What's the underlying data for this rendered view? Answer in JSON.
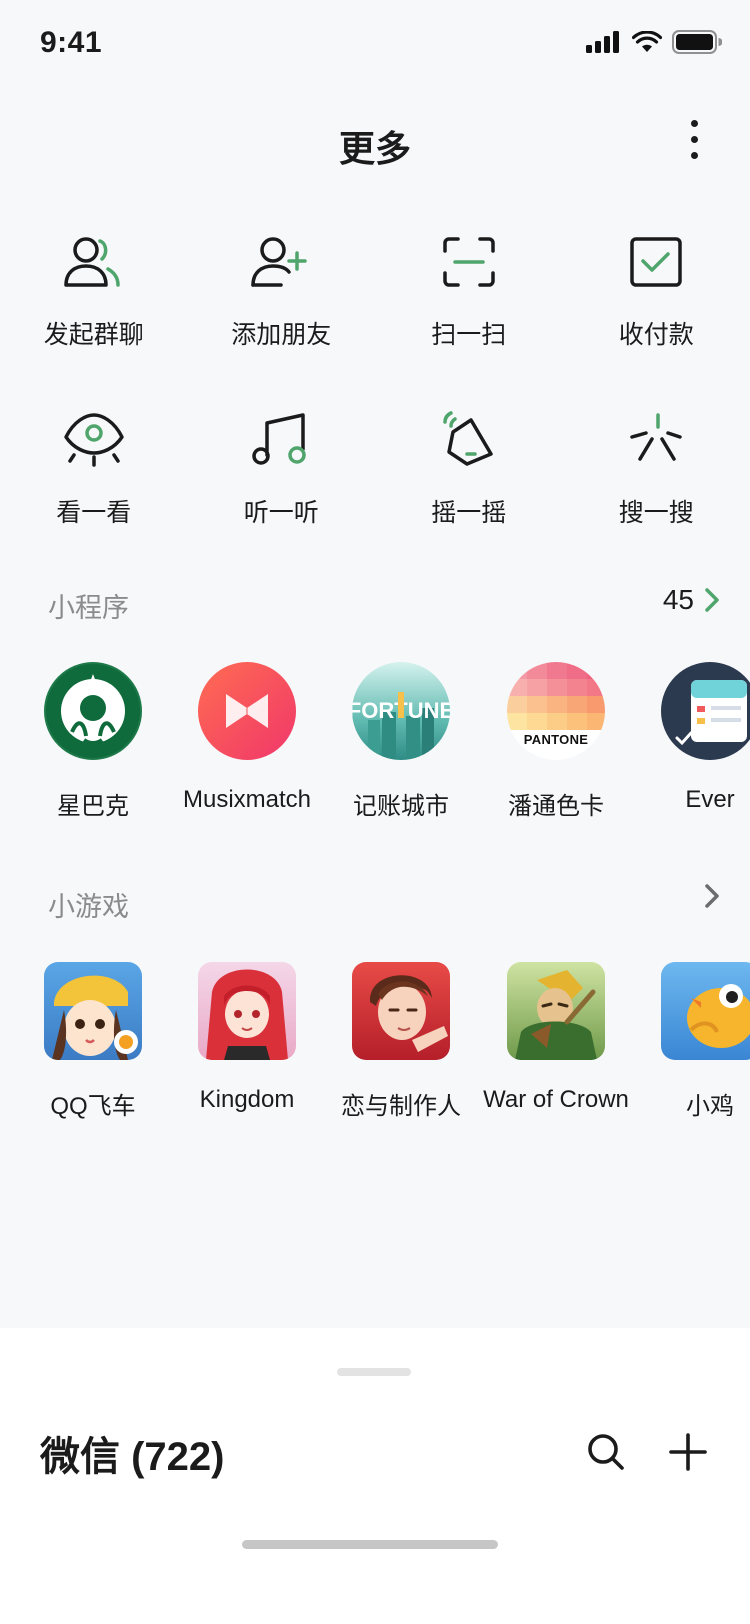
{
  "status_bar": {
    "time": "9:41"
  },
  "header": {
    "title": "更多"
  },
  "actions": [
    {
      "label": "发起群聊",
      "icon": "group-chat-icon"
    },
    {
      "label": "添加朋友",
      "icon": "add-friend-icon"
    },
    {
      "label": "扫一扫",
      "icon": "scan-icon"
    },
    {
      "label": "收付款",
      "icon": "payment-icon"
    },
    {
      "label": "看一看",
      "icon": "eye-icon"
    },
    {
      "label": "听一听",
      "icon": "music-note-icon"
    },
    {
      "label": "摇一摇",
      "icon": "shake-phone-icon"
    },
    {
      "label": "搜一搜",
      "icon": "search-star-icon"
    }
  ],
  "mini_programs": {
    "title": "小程序",
    "count": "45",
    "items": [
      {
        "name": "星巴克",
        "icon": "starbucks-logo"
      },
      {
        "name": "Musixmatch",
        "icon": "musixmatch-logo"
      },
      {
        "name": "记账城市",
        "icon": "fortune-city-logo"
      },
      {
        "name": "潘通色卡",
        "icon": "pantone-logo",
        "logo_text": "PANTONE"
      },
      {
        "name": "Ever",
        "icon": "ever-app-logo"
      }
    ]
  },
  "mini_games": {
    "title": "小游戏",
    "items": [
      {
        "name": "QQ飞车",
        "icon": "qq-speed-game-icon"
      },
      {
        "name": "Kingdom",
        "icon": "kingdom-game-icon"
      },
      {
        "name": "恋与制作人",
        "icon": "love-producer-game-icon"
      },
      {
        "name": "War of Crown",
        "icon": "war-of-crown-game-icon"
      },
      {
        "name": "小鸡",
        "icon": "chick-game-icon"
      }
    ]
  },
  "bottom_sheet": {
    "title": "微信 (722)"
  },
  "colors": {
    "accent": "#4fa56b",
    "text": "#1b1b1b",
    "muted": "#8b8b8b",
    "background": "#f7f8fa"
  }
}
